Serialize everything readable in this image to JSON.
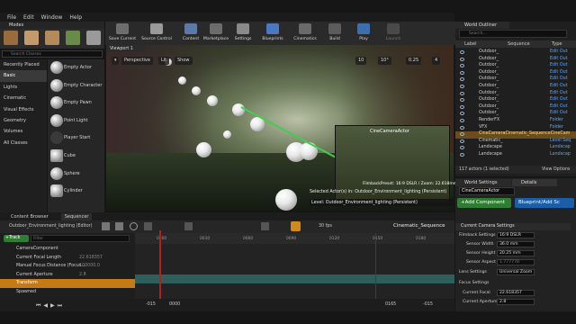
{
  "window": {
    "modes_tab": "Modes"
  },
  "menu": [
    "File",
    "Edit",
    "Window",
    "Help"
  ],
  "toolbar": [
    {
      "label": "Save Current",
      "color": "#6d6d6d"
    },
    {
      "label": "Source Control",
      "color": "#9a9a9a"
    },
    {
      "label": "Content",
      "color": "#5a7aa8"
    },
    {
      "label": "Marketplace",
      "color": "#6c6c6c"
    },
    {
      "label": "Settings",
      "color": "#8a8a8a"
    },
    {
      "label": "Blueprints",
      "color": "#4b78c0"
    },
    {
      "label": "Cinematics",
      "color": "#6a6a6a"
    },
    {
      "label": "Build",
      "color": "#5c5c5c"
    },
    {
      "label": "Play",
      "color": "#3d6fb0"
    },
    {
      "label": "Launch",
      "color": "#4a4a4a"
    }
  ],
  "placement": {
    "search_placeholder": "Search Classes",
    "categories": [
      "Recently Placed",
      "Basic",
      "Lights",
      "Cinematic",
      "Visual Effects",
      "Geometry",
      "Volumes",
      "All Classes"
    ],
    "selected_category": "Basic",
    "items": [
      "Empty Actor",
      "Empty Character",
      "Empty Pawn",
      "Point Light",
      "Player Start",
      "Cube",
      "Sphere",
      "Cylinder"
    ]
  },
  "viewport": {
    "tab": "Viewport 1",
    "perspective": "Perspective",
    "lit": "Lit",
    "show": "Show",
    "grid_value": "10",
    "angle_value": "10°",
    "scale_value": "0.25",
    "camera_speed": "4",
    "inset_label": "CineCameraActor",
    "inset_info": "FilmbackPreset: 16:9 DSLR / Zoom: 22.618mm",
    "selected_info": "Selected Actor(s) in: Outdoor_Environment_lighting (Persistent)",
    "level_info": "Level: Outdoor_Environment_lighting (Persistent)"
  },
  "outliner": {
    "tab": "World Outliner",
    "search_placeholder": "Search...",
    "col_label": "Label",
    "col_sequence": "Sequence",
    "col_type": "Type",
    "rows": [
      {
        "name": "Outdoor_",
        "type": "Edit Out"
      },
      {
        "name": "Outdoor_",
        "type": "Edit Out"
      },
      {
        "name": "Outdoor_",
        "type": "Edit Out"
      },
      {
        "name": "Outdoor_",
        "type": "Edit Out"
      },
      {
        "name": "Outdoor_",
        "type": "Edit Out"
      },
      {
        "name": "Outdoor_",
        "type": "Edit Out"
      },
      {
        "name": "Outdoor_",
        "type": "Edit Out"
      },
      {
        "name": "Outdoor_",
        "type": "Edit Out"
      },
      {
        "name": "Outdoor_",
        "type": "Edit Out"
      },
      {
        "name": "Outdoor_",
        "type": "Edit Out"
      },
      {
        "name": "RenderFX",
        "type": "Folder"
      },
      {
        "name": "VFX",
        "type": "Folder"
      },
      {
        "name": "CineCameraCinematic_SequenceCineCam",
        "type": ""
      },
      {
        "name": "Cinematic_",
        "type": "Level Seq"
      },
      {
        "name": "Landscape",
        "type": "Landscap"
      },
      {
        "name": "Landscape",
        "type": "Landscap"
      }
    ],
    "selected_index": 12,
    "actor_count": "117 actors (1 selected)",
    "view_options": "View Options"
  },
  "details": {
    "tab_world": "World Settings",
    "tab_details": "Details",
    "actor_name": "CineCameraActor",
    "add_component": "+Add Component",
    "blueprint": "Blueprint/Add Sc",
    "current_camera": "Current Camera Settings",
    "filmback": "Filmback Settings",
    "filmback_value": "16:9 DSLR",
    "sensor_width_label": "Sensor Width",
    "sensor_width": "36.0 mm",
    "sensor_height_label": "Sensor Height",
    "sensor_height": "20.25 mm",
    "sensor_aspect_label": "Sensor Aspect",
    "sensor_aspect": "1.777778",
    "lens_label": "Lens Settings",
    "lens_value": "Universal Zoom",
    "focus_label": "Focus Settings",
    "focal_label": "Current Focal",
    "focal_value": "22.618357",
    "aperture_label": "Current Aperture",
    "aperture_value": "2.8"
  },
  "sequencer": {
    "tab_content": "Content Browser",
    "tab_sequencer": "Sequencer",
    "sequence_path": "Outdoor_Environment_lighting (Editor)",
    "sequence_name": "Cinematic_Sequence",
    "fps": "30 fps",
    "track_button": "+Track",
    "filter_placeholder": "Filter",
    "tracks": [
      {
        "label": "CameraComponent",
        "value": ""
      },
      {
        "label": "Current Focal Length",
        "value": "22.618357"
      },
      {
        "label": "Manual Focus Distance (Focus...",
        "value": "100000.0"
      },
      {
        "label": "Current Aperture",
        "value": "2.8"
      },
      {
        "label": "Transform",
        "value": ""
      },
      {
        "label": "Spawned",
        "value": ""
      }
    ],
    "selected_track": 4,
    "ruler": [
      "0000",
      "0030",
      "0060",
      "0090",
      "0120",
      "0150",
      "0180"
    ],
    "frame_start": "-015",
    "frame_cur": "0000",
    "frame_end": "-015",
    "frame_right": "0165"
  }
}
